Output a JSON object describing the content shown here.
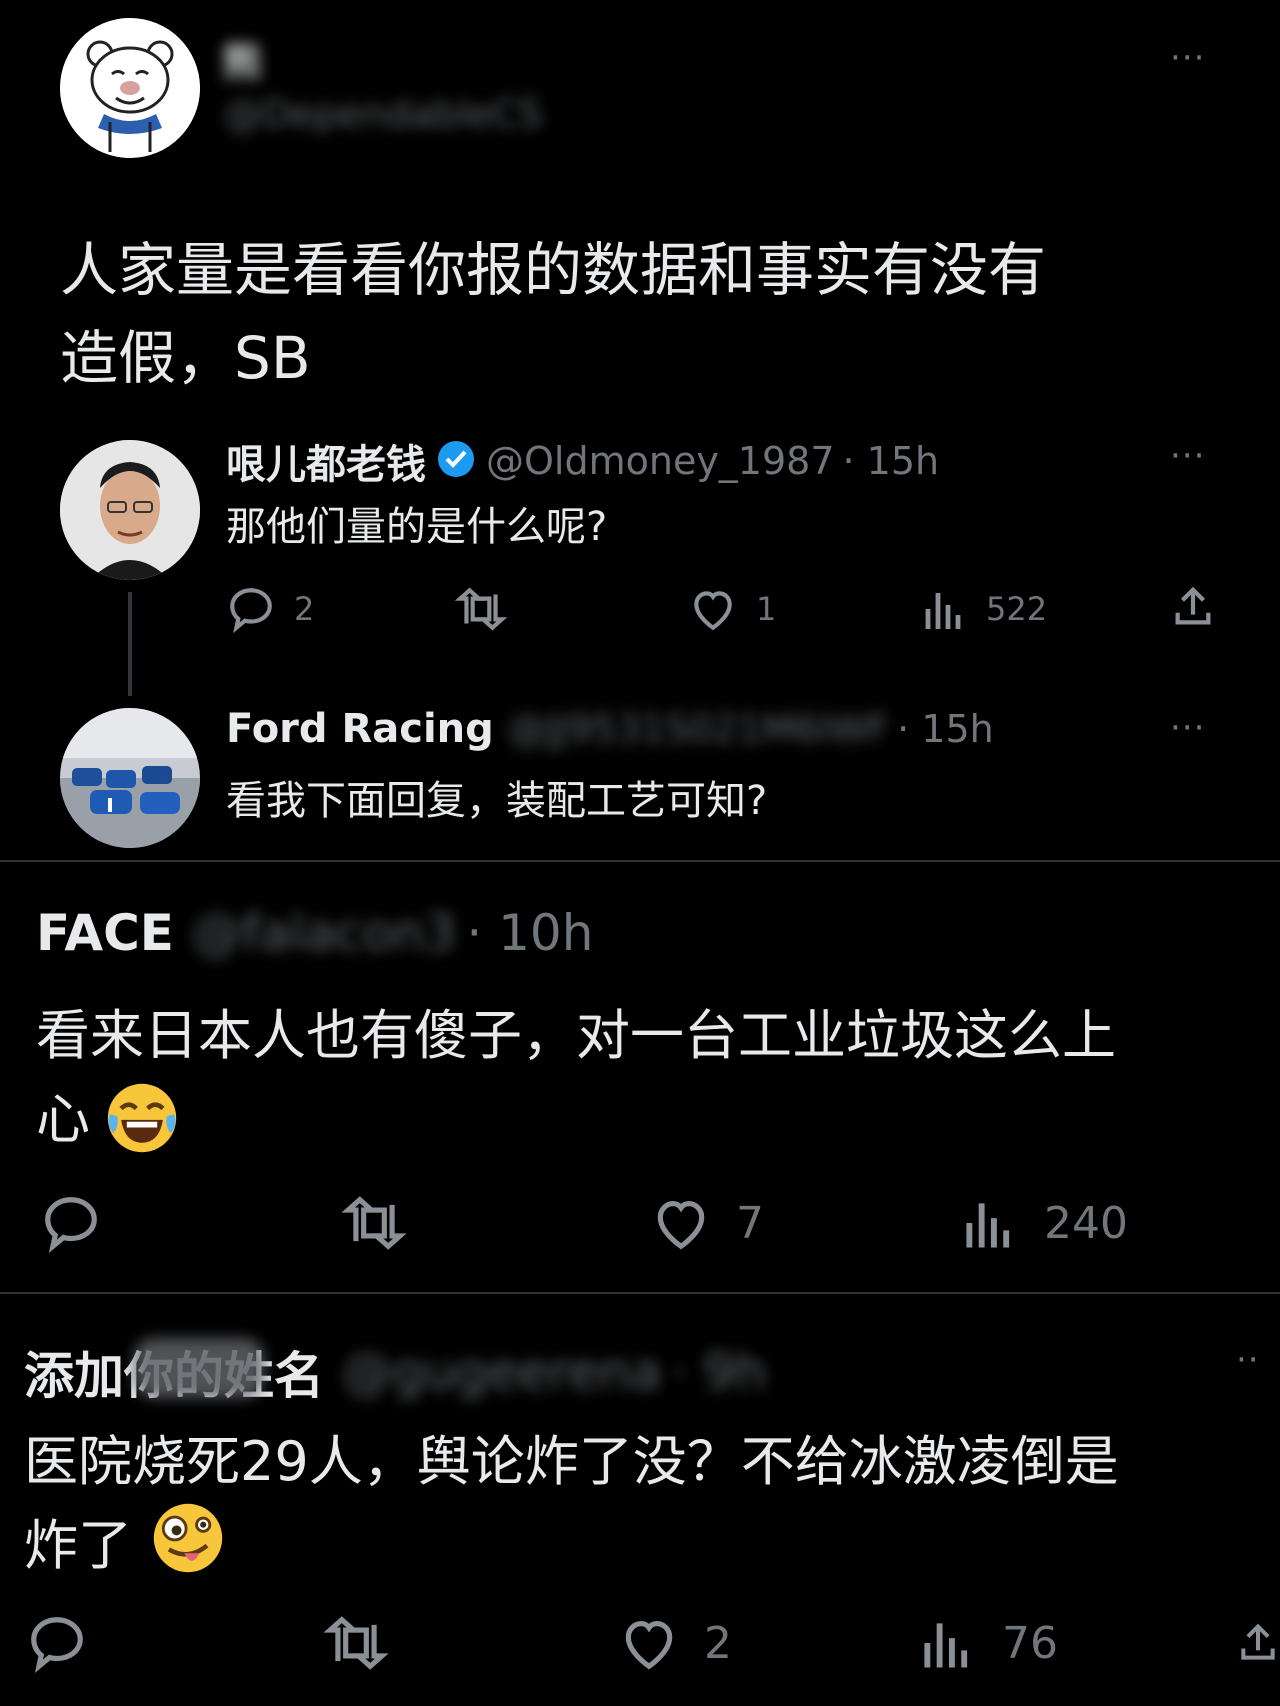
{
  "tweets": {
    "t1": {
      "name": "熊",
      "handle": "@DependableCS",
      "more": "···",
      "text": "人家量是看看你报的数据和事实有没有\n造假，SB"
    },
    "t2": {
      "name": "哏儿都老钱",
      "handle": "@Oldmoney_1987",
      "time": "· 15h",
      "more": "···",
      "text": "那他们量的是什么呢?",
      "replies": "2",
      "likes": "1",
      "views": "522"
    },
    "t3": {
      "name": "Ford Racing",
      "handle": "@JJ9531S021M6IWF",
      "time": "· 15h",
      "more": "···",
      "text": "看我下面回复，装配工艺可知?"
    },
    "t4": {
      "name": "FACE",
      "handle": "@falacon3",
      "time": "· 10h",
      "text": "看来日本人也有傻子，对一台工业垃圾这么上\n心",
      "likes": "7",
      "views": "240"
    },
    "t5": {
      "name": "添加你的姓名",
      "handle": "@gugeerena",
      "time": "· 9h",
      "more": "··",
      "text_line1": "医院烧死29人，舆论炸了没？不给冰激凌倒是",
      "text_line2": "炸了",
      "likes": "2",
      "views": "76"
    }
  },
  "icons": [
    "reply-icon",
    "retweet-icon",
    "like-icon",
    "views-icon",
    "share-icon",
    "verified-badge-icon",
    "laughing-emoji-icon",
    "zany-face-emoji-icon"
  ],
  "colors": {
    "background": "#000000",
    "text": "#e7e9ea",
    "secondary": "#71767b",
    "verified": "#1d9bf0"
  }
}
